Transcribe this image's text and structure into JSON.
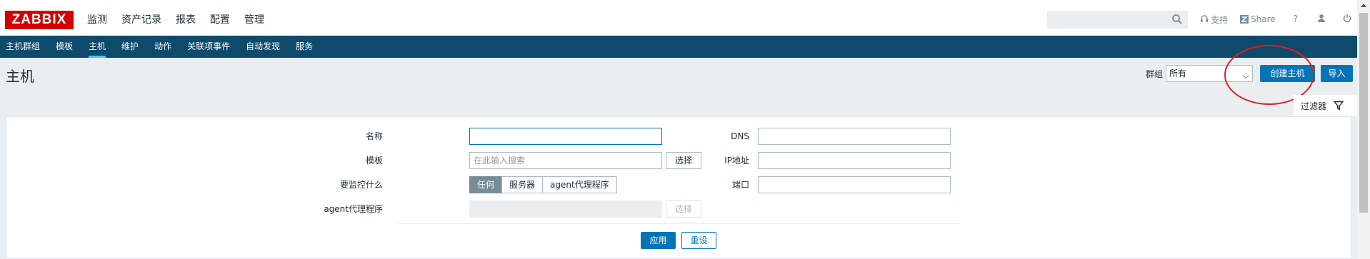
{
  "logo": "ZABBIX",
  "main_nav": [
    "监测",
    "资产记录",
    "报表",
    "配置",
    "管理"
  ],
  "main_nav_active": "配置",
  "top_right": {
    "search_placeholder": "",
    "support_label": "支持",
    "share_label": "Share",
    "help_label": "?"
  },
  "sub_nav": [
    "主机群组",
    "模板",
    "主机",
    "维护",
    "动作",
    "关联项事件",
    "自动发现",
    "服务"
  ],
  "sub_nav_active": "主机",
  "header": {
    "title": "主机",
    "group_label": "群组",
    "group_value": "所有",
    "create_label": "创建主机",
    "import_label": "导入"
  },
  "filter": {
    "tab_label": "过滤器",
    "name_label": "名称",
    "name_value": "",
    "template_label": "模板",
    "template_placeholder": "在此输入搜索",
    "select_label": "选择",
    "monitor_label": "要监控什么",
    "monitor_options": [
      "任何",
      "服务器",
      "agent代理程序"
    ],
    "monitor_selected": "任何",
    "proxy_label": "agent代理程序",
    "proxy_select_label": "选择",
    "dns_label": "DNS",
    "ip_label": "IP地址",
    "port_label": "端口",
    "apply_label": "应用",
    "reset_label": "重设"
  },
  "colors": {
    "brand": "#d40000",
    "nav_bar": "#0e4a6b",
    "primary_button": "#0275b8",
    "annotation_circle": "#e02020"
  }
}
